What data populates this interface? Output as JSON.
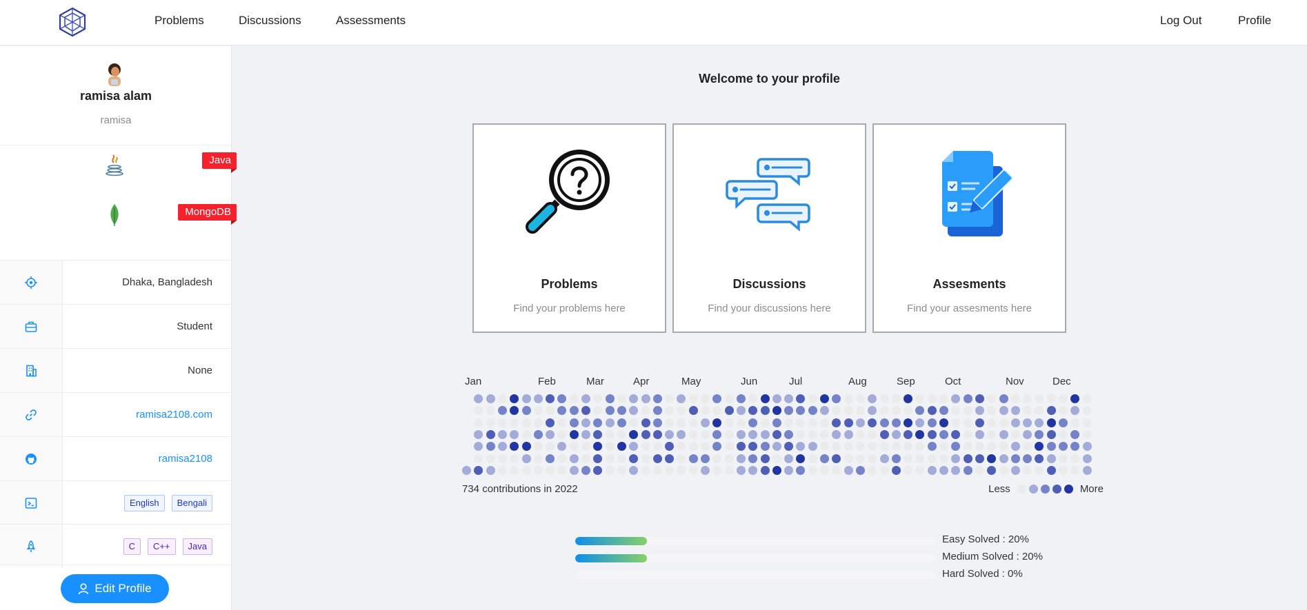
{
  "nav": {
    "links": [
      "Problems",
      "Discussions",
      "Assessments"
    ],
    "right_links": [
      "Log Out",
      "Profile"
    ]
  },
  "profile": {
    "name": "ramisa alam",
    "username": "ramisa",
    "skills": [
      {
        "label": "Java",
        "icon": "java-icon"
      },
      {
        "label": "MongoDB",
        "icon": "mongodb-leaf-icon"
      }
    ],
    "location": "Dhaka, Bangladesh",
    "occupation": "Student",
    "organization": "None",
    "website": "ramisa2108.com",
    "github": "ramisa2108",
    "spoken_languages": [
      "English",
      "Bengali"
    ],
    "programming_languages": [
      "C",
      "C++",
      "Java"
    ],
    "edit_button": "Edit Profile"
  },
  "main": {
    "welcome": "Welcome to your profile",
    "cards": [
      {
        "title": "Problems",
        "description": "Find your problems here",
        "icon": "magnifier-question-icon"
      },
      {
        "title": "Discussions",
        "description": "Find your discussions here",
        "icon": "chat-bubbles-icon"
      },
      {
        "title": "Assesments",
        "description": "Find your assesments here",
        "icon": "checklist-document-icon"
      }
    ]
  },
  "heatmap": {
    "months": [
      "Jan",
      "Feb",
      "Mar",
      "Apr",
      "May",
      "Jun",
      "Jul",
      "Aug",
      "Sep",
      "Oct",
      "Nov",
      "Dec"
    ],
    "total_text": "734 contributions in 2022",
    "legend_less": "Less",
    "legend_more": "More",
    "colors": [
      "#ebebeb",
      "#a3acd9",
      "#7584c8",
      "#4f5fb5",
      "#2135a0"
    ]
  },
  "progress": [
    {
      "label": "Easy Solved : 20%",
      "percent": 20
    },
    {
      "label": "Medium Solved : 20%",
      "percent": 20
    },
    {
      "label": "Hard Solved : 0%",
      "percent": 0
    }
  ],
  "colors": {
    "accent": "#1890ff",
    "tag_red": "#f5222d"
  }
}
